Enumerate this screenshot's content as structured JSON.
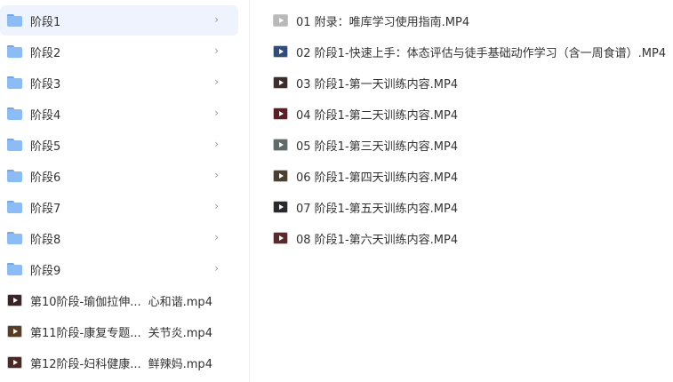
{
  "sidebar": {
    "folders": [
      {
        "label": "阶段1",
        "selected": true
      },
      {
        "label": "阶段2",
        "selected": false
      },
      {
        "label": "阶段3",
        "selected": false
      },
      {
        "label": "阶段4",
        "selected": false
      },
      {
        "label": "阶段5",
        "selected": false
      },
      {
        "label": "阶段6",
        "selected": false
      },
      {
        "label": "阶段7",
        "selected": false
      },
      {
        "label": "阶段8",
        "selected": false
      },
      {
        "label": "阶段9",
        "selected": false
      }
    ],
    "chevron": "›",
    "files": [
      {
        "label_start": "第10阶段-瑜伽拉伸...",
        "label_end": "心和谐.mp4",
        "thumb": "#3a2428"
      },
      {
        "label_start": "第11阶段-康复专题...",
        "label_end": "关节炎.mp4",
        "thumb": "#5a3c22"
      },
      {
        "label_start": "第12阶段-妇科健康...",
        "label_end": "鲜辣妈.mp4",
        "thumb": "#4a2a22"
      }
    ]
  },
  "content": {
    "files": [
      {
        "label": "01 附录：唯库学习使用指南.MP4",
        "thumb": "#b9b9b9"
      },
      {
        "label": "02 阶段1-快速上手：体态评估与徒手基础动作学习（含一周食谱）.MP4",
        "thumb": "#2e4d7a"
      },
      {
        "label": "03 阶段1-第一天训练内容.MP4",
        "thumb": "#3d2e2a"
      },
      {
        "label": "04 阶段1-第二天训练内容.MP4",
        "thumb": "#5c1e22"
      },
      {
        "label": "05 阶段1-第三天训练内容.MP4",
        "thumb": "#5f6a6a"
      },
      {
        "label": "06 阶段1-第四天训练内容.MP4",
        "thumb": "#4a4030"
      },
      {
        "label": "07 阶段1-第五天训练内容.MP4",
        "thumb": "#2a2a2e"
      },
      {
        "label": "08 阶段1-第六天训练内容.MP4",
        "thumb": "#5a2a2a"
      }
    ]
  },
  "colors": {
    "selected_bg": "#eef3fd",
    "folder": "#8cbcf5",
    "text": "#333333",
    "chevron": "#999999"
  }
}
